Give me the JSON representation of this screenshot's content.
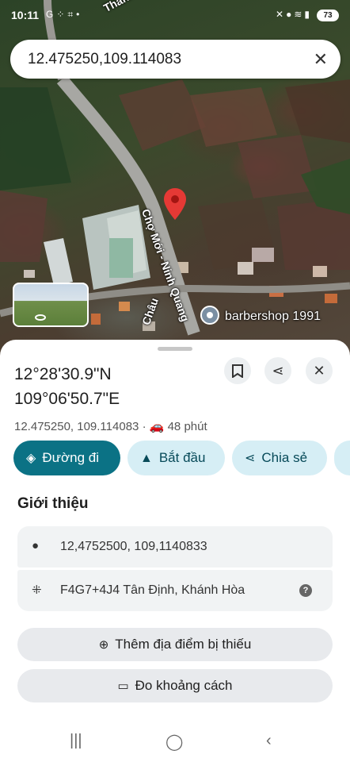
{
  "status_bar": {
    "time": "10:11",
    "battery": "73",
    "left_icons": [
      "google-icon",
      "dots-icon",
      "screenshot-icon",
      "dot-icon"
    ],
    "right_icons": [
      "mute-icon",
      "location-icon",
      "wifi-icon",
      "signal-icon"
    ]
  },
  "search": {
    "query": "12.475250,109.114083",
    "clear_icon": "close-icon"
  },
  "map": {
    "labels": {
      "top_road": "Thành",
      "main_road": "Chợ Mới - Ninh Quang",
      "lower_road": "Châu",
      "poi": "barbershop 1991"
    },
    "pin_color": "#e53935",
    "poi_color": "#7b8fa3"
  },
  "place": {
    "title_line1": "12°28'30.9\"N",
    "title_line2": "109°06'50.7\"E",
    "coords": "12.475250, 109.114083",
    "separator": "·",
    "travel_time": "48 phút",
    "actions": {
      "directions": "Đường đi",
      "start": "Bắt đầu",
      "share": "Chia sẻ"
    },
    "section_title": "Giới thiệu",
    "coords_detail": "12,4752500, 109,1140833",
    "plus_code": "F4G7+4J4 Tân Định, Khánh Hòa",
    "add_missing": "Thêm địa điểm bị thiếu",
    "measure": "Đo khoảng cách"
  },
  "colors": {
    "primary": "#0b7285",
    "secondary_chip": "#d6eef5",
    "card_bg": "#f1f3f4"
  }
}
